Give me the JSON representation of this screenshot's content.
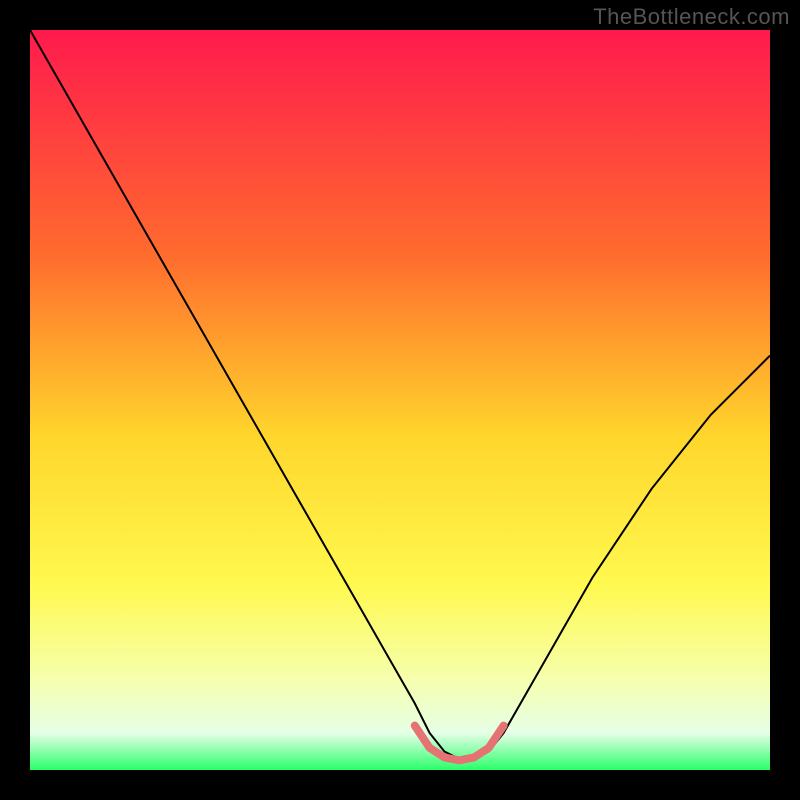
{
  "watermark": "TheBottleneck.com",
  "chart_data": {
    "type": "line",
    "title": "",
    "xlabel": "",
    "ylabel": "",
    "xlim": [
      0,
      100
    ],
    "ylim": [
      0,
      100
    ],
    "background_gradient_stops": [
      {
        "offset": 0,
        "color": "#ff1a4d"
      },
      {
        "offset": 30,
        "color": "#ff6a2e"
      },
      {
        "offset": 55,
        "color": "#ffd62c"
      },
      {
        "offset": 75,
        "color": "#fff94f"
      },
      {
        "offset": 88,
        "color": "#f5ffb0"
      },
      {
        "offset": 95,
        "color": "#e6ffe6"
      },
      {
        "offset": 100,
        "color": "#2aff6a"
      }
    ],
    "series": [
      {
        "name": "bottleneck-curve",
        "color": "#000000",
        "width": 2,
        "x": [
          0,
          4,
          8,
          12,
          16,
          20,
          24,
          28,
          32,
          36,
          40,
          44,
          48,
          52,
          54,
          56,
          58,
          60,
          62,
          64,
          68,
          72,
          76,
          80,
          84,
          88,
          92,
          96,
          100
        ],
        "y": [
          100,
          93,
          86,
          79,
          72,
          65,
          58,
          51,
          44,
          37,
          30,
          23,
          16,
          9,
          5,
          2.5,
          1.5,
          1.5,
          2.5,
          5,
          12,
          19,
          26,
          32,
          38,
          43,
          48,
          52,
          56
        ]
      },
      {
        "name": "optimal-range-marker",
        "color": "#e57373",
        "width": 8,
        "x": [
          52,
          54,
          56,
          58,
          60,
          62,
          64
        ],
        "y": [
          6,
          3,
          1.7,
          1.3,
          1.7,
          3,
          6
        ]
      }
    ]
  }
}
